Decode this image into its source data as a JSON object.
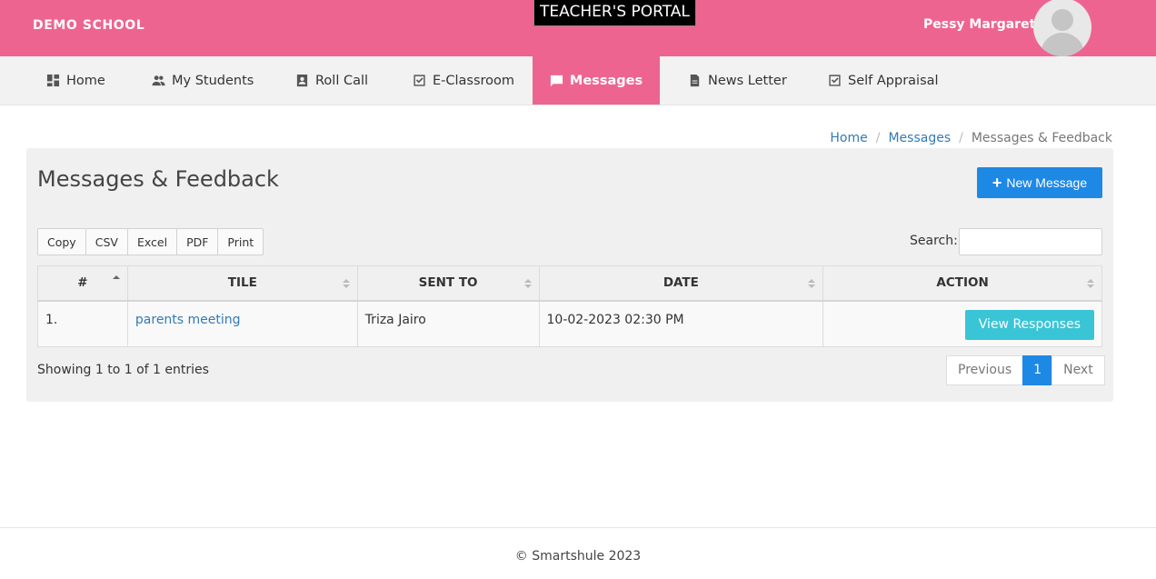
{
  "header": {
    "school": "DEMO SCHOOL",
    "portal": "TEACHER'S PORTAL",
    "user_name": "Pessy Margaret",
    "accent_color": "#ee6490"
  },
  "nav": [
    {
      "label": "Home",
      "icon": "dashboard-icon"
    },
    {
      "label": "My Students",
      "icon": "people-icon"
    },
    {
      "label": "Roll Call",
      "icon": "contact-card-icon"
    },
    {
      "label": "E-Classroom",
      "icon": "checkbox-icon"
    },
    {
      "label": "Messages",
      "icon": "chat-bubble-icon",
      "active": true
    },
    {
      "label": "News Letter",
      "icon": "document-icon"
    },
    {
      "label": "Self Appraisal",
      "icon": "checkbox-icon"
    }
  ],
  "breadcrumb": [
    "Home",
    "Messages",
    "Messages & Feedback"
  ],
  "page": {
    "title": "Messages & Feedback",
    "new_button": "New Message",
    "export_buttons": [
      "Copy",
      "CSV",
      "Excel",
      "PDF",
      "Print"
    ],
    "search_label": "Search:",
    "search_value": ""
  },
  "table": {
    "columns": [
      "#",
      "TILE",
      "SENT TO",
      "DATE",
      "ACTION"
    ],
    "rows": [
      {
        "num": "1.",
        "title": "parents meeting",
        "sent_to": "Triza Jairo",
        "date": "10-02-2023 02:30 PM",
        "action": "View Responses"
      }
    ]
  },
  "info": "Showing 1 to 1 of 1 entries",
  "pager": {
    "previous": "Previous",
    "current": "1",
    "next": "Next"
  },
  "footer": "© Smartshule 2023"
}
